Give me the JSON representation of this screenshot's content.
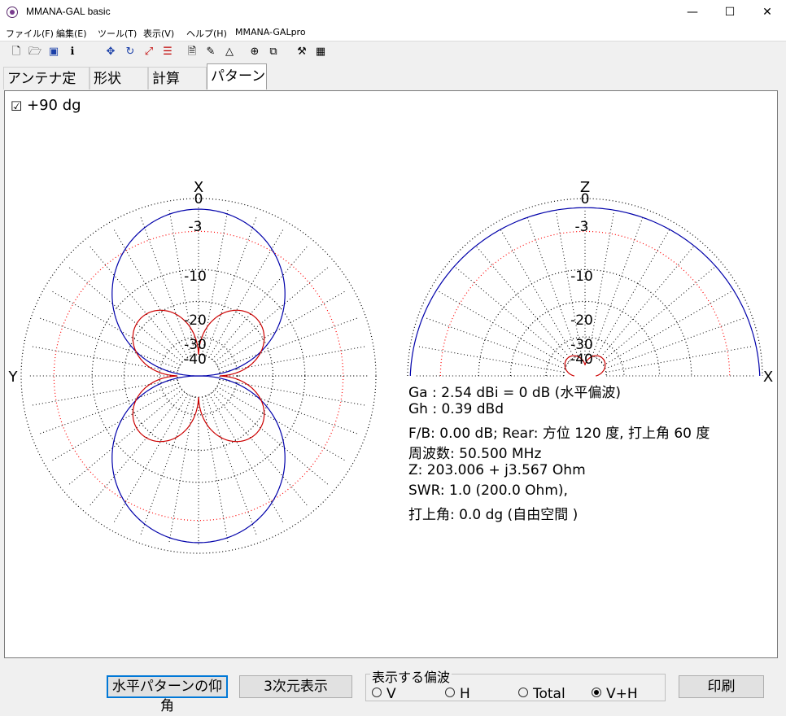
{
  "window": {
    "title": "MMANA-GAL basic",
    "minimize": "—",
    "maximize": "☐",
    "close": "✕"
  },
  "menu": [
    "ファイル(F)",
    "編集(E)",
    "ツール(T)",
    "表示(V)",
    "ヘルプ(H)",
    "MMANA-GALpro"
  ],
  "toolbar": {
    "icons": [
      "new-file-icon",
      "open-folder-icon",
      "save-icon",
      "info-icon",
      "move-icon",
      "rotate-icon",
      "scale-icon",
      "split-wire-icon",
      "page-icon",
      "pen-icon",
      "triangle-icon",
      "target-icon",
      "copy-icon",
      "tools-icon",
      "calculator-icon"
    ]
  },
  "tabs": [
    "アンテナ定義",
    "形状",
    "計算",
    "パターン"
  ],
  "active_tab": "パターン",
  "pattern": {
    "checkbox_label": "+90 dg",
    "checkbox_checked": true,
    "horizontal_axis_top": "X",
    "horizontal_axis_left": "Y",
    "vertical_axis_top": "Z",
    "vertical_axis_right": "X",
    "ring_labels": [
      "0",
      "-3",
      "-10",
      "-20",
      "-30",
      "-40"
    ],
    "colors": {
      "main": "#0000aa",
      "secondary": "#cc0000",
      "grid": "#000000",
      "minus3_ring": "#ff0000"
    }
  },
  "results": {
    "ga": "Ga : 2.54 dBi = 0 dB  (水平偏波)",
    "gh": "Gh : 0.39 dBd",
    "fb": "F/B: 0.00 dB; Rear: 方位 120 度,  打上角 60 度",
    "freq": "周波数: 50.500 MHz",
    "z": "Z: 203.006 + j3.567 Ohm",
    "swr": "SWR: 1.0 (200.0 Ohm),",
    "elev": "打上角: 0.0 dg (自由空間 )"
  },
  "buttons": {
    "elevation": "水平パターンの仰角",
    "view3d": "3次元表示",
    "print": "印刷"
  },
  "polarization": {
    "title": "表示する偏波",
    "options": [
      "V",
      "H",
      "Total",
      "V+H"
    ],
    "selected": "V+H"
  }
}
